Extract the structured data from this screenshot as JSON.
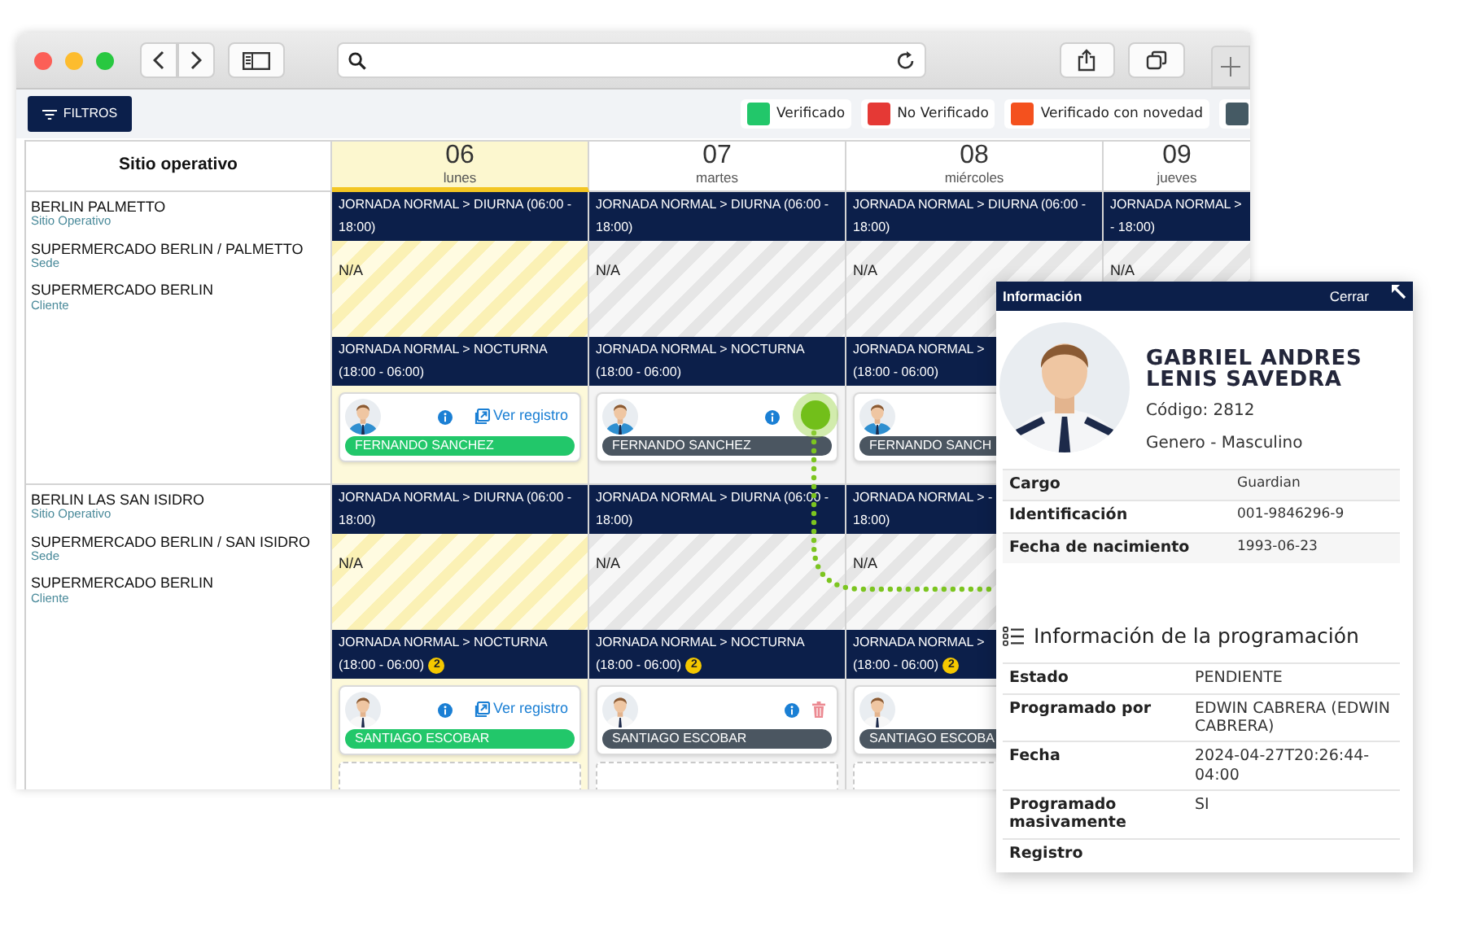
{
  "toolbar": {
    "filter_button": "FILTROS",
    "legend": [
      {
        "label": "Verificado",
        "color": "#22c76a"
      },
      {
        "label": "No Verificado",
        "color": "#e53935"
      },
      {
        "label": "Verificado con novedad",
        "color": "#f4511e"
      },
      {
        "color": "#455a64"
      }
    ]
  },
  "calendar": {
    "site_heading": "Sitio operativo",
    "days": [
      {
        "day": "06",
        "weekday": "lunes",
        "selected": true
      },
      {
        "day": "07",
        "weekday": "martes",
        "selected": false
      },
      {
        "day": "08",
        "weekday": "miércoles",
        "selected": false
      },
      {
        "day": "09",
        "weekday": "jueves",
        "selected": false
      }
    ],
    "sites": [
      {
        "lines": [
          {
            "title": "BERLIN PALMETTO",
            "subtitle": "Sitio Operativo"
          },
          {
            "title": "SUPERMERCADO BERLIN / PALMETTO",
            "subtitle": "Sede"
          },
          {
            "title": "SUPERMERCADO BERLIN",
            "subtitle": "Cliente"
          }
        ],
        "cells": [
          {
            "shifts": [
              {
                "label": "JORNADA NORMAL > DIURNA (06:00 - 18:00)",
                "note": "N/A"
              },
              {
                "label": "JORNADA NORMAL > NOCTURNA (18:00 - 06:00)",
                "entries": [
                  {
                    "kind": "person",
                    "name": "FERNANDO SANCHEZ",
                    "color": "#22c76a",
                    "info": true,
                    "link": "Ver registro"
                  }
                ]
              }
            ]
          },
          {
            "shifts": [
              {
                "label": "JORNADA NORMAL > DIURNA (06:00 - 18:00)",
                "note": "N/A"
              },
              {
                "label": "JORNADA NORMAL > NOCTURNA (18:00 - 06:00)",
                "entries": [
                  {
                    "kind": "person",
                    "name": "FERNANDO SANCHEZ",
                    "color": "#4b5661",
                    "info": true
                  }
                ]
              }
            ]
          },
          {
            "shifts": [
              {
                "label": "JORNADA NORMAL > DIURNA (06:00 - 18:00)",
                "note": "N/A"
              },
              {
                "label": "JORNADA NORMAL > (18:00 - 06:00)",
                "entries": [
                  {
                    "kind": "person",
                    "name": "FERNANDO SANCH",
                    "color": "#4b5661"
                  }
                ]
              }
            ]
          },
          {
            "shifts": [
              {
                "label": "JORNADA NORMAL > - 18:00)",
                "note": "N/A"
              }
            ]
          }
        ]
      },
      {
        "lines": [
          {
            "title": "BERLIN LAS SAN ISIDRO",
            "subtitle": "Sitio Operativo"
          },
          {
            "title": "SUPERMERCADO BERLIN / SAN ISIDRO",
            "subtitle": "Sede"
          },
          {
            "title": "SUPERMERCADO BERLIN",
            "subtitle": "Cliente"
          }
        ],
        "cells": [
          {
            "shifts": [
              {
                "label": "JORNADA NORMAL > DIURNA (06:00 - 18:00)",
                "note": "N/A"
              },
              {
                "label": "JORNADA NORMAL > NOCTURNA (18:00 - 06:00)",
                "badge": "2",
                "entries": [
                  {
                    "kind": "person",
                    "name": "SANTIAGO ESCOBAR",
                    "color": "#22c76a",
                    "info": true,
                    "link": "Ver registro"
                  },
                  {
                    "kind": "empty"
                  }
                ]
              }
            ]
          },
          {
            "shifts": [
              {
                "label": "JORNADA NORMAL > DIURNA (06:00 - 18:00)",
                "note": "N/A"
              },
              {
                "label": "JORNADA NORMAL > NOCTURNA (18:00 - 06:00)",
                "badge": "2",
                "entries": [
                  {
                    "kind": "person",
                    "name": "SANTIAGO ESCOBAR",
                    "color": "#4b5661",
                    "info": true,
                    "delete": true
                  },
                  {
                    "kind": "empty"
                  }
                ]
              }
            ]
          },
          {
            "shifts": [
              {
                "label": "JORNADA NORMAL > - 18:00)",
                "note": "N/A"
              },
              {
                "label": "JORNADA NORMAL > (18:00 - 06:00)",
                "badge": "2",
                "entries": [
                  {
                    "kind": "person",
                    "name": "SANTIAGO ESCOBA",
                    "color": "#4b5661"
                  },
                  {
                    "kind": "empty"
                  }
                ]
              }
            ]
          }
        ]
      }
    ]
  },
  "panel": {
    "title": "Información",
    "close": "Cerrar",
    "person": {
      "name": "GABRIEL ANDRES LENIS SAVEDRA",
      "code": "Código: 2812",
      "gender": "Genero - Masculino"
    },
    "details": [
      {
        "label": "Cargo",
        "value": "Guardian"
      },
      {
        "label": "Identificación",
        "value": "001-9846296-9"
      },
      {
        "label": "Fecha de nacimiento",
        "value": "1993-06-23"
      }
    ],
    "section_title": "Información de la programación",
    "schedule_info": [
      {
        "label": "Estado",
        "value": "PENDIENTE"
      },
      {
        "label": "Programado por",
        "value": "EDWIN CABRERA (EDWIN CABRERA)"
      },
      {
        "label": "Fecha",
        "value": "2024-04-27T20:26:44-04:00"
      },
      {
        "label": "Programado masivamente",
        "value": "SI"
      },
      {
        "label": "Registro"
      }
    ]
  }
}
